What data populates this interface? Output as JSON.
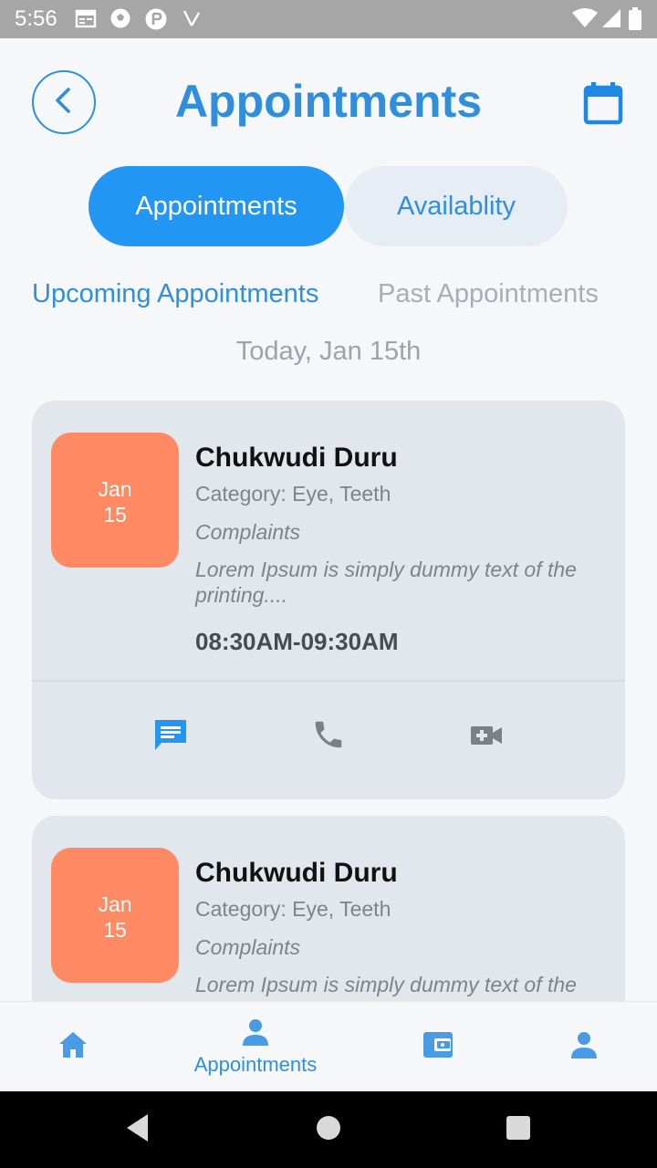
{
  "status_bar": {
    "time": "5:56"
  },
  "header": {
    "title": "Appointments"
  },
  "segmented": {
    "appointments_label": "Appointments",
    "availability_label": "Availablity"
  },
  "subtabs": {
    "upcoming_label": "Upcoming Appointments",
    "past_label": "Past Appointments"
  },
  "date_heading": "Today, Jan 15th",
  "appointments": [
    {
      "month": "Jan",
      "day": "15",
      "name": "Chukwudi Duru",
      "category": "Category: Eye, Teeth",
      "complaints_label": "Complaints",
      "description": "Lorem Ipsum is simply dummy text of the printing....",
      "time": "08:30AM-09:30AM"
    },
    {
      "month": "Jan",
      "day": "15",
      "name": "Chukwudi Duru",
      "category": "Category: Eye, Teeth",
      "complaints_label": "Complaints",
      "description": "Lorem Ipsum is simply dummy text of the"
    }
  ],
  "bottom_nav": {
    "appointments_label": "Appointments"
  },
  "colors": {
    "accent": "#2196f3",
    "accent_text": "#2f8fdc",
    "date_box": "#ff8a63",
    "card_bg": "#e2e7ee",
    "muted_text": "#7e838c"
  },
  "icons": {
    "status": [
      "calendar-icon",
      "soccer-icon",
      "app-icon",
      "missed-icon",
      "wifi-icon",
      "signal-icon",
      "battery-icon"
    ],
    "header": [
      "back-arrow-icon",
      "calendar-icon"
    ],
    "card_actions": [
      "chat-icon",
      "phone-icon",
      "video-call-icon"
    ],
    "bottom_nav": [
      "home-icon",
      "person-icon",
      "wallet-icon",
      "profile-icon"
    ],
    "system": [
      "back-triangle-icon",
      "home-circle-icon",
      "recents-square-icon"
    ]
  }
}
